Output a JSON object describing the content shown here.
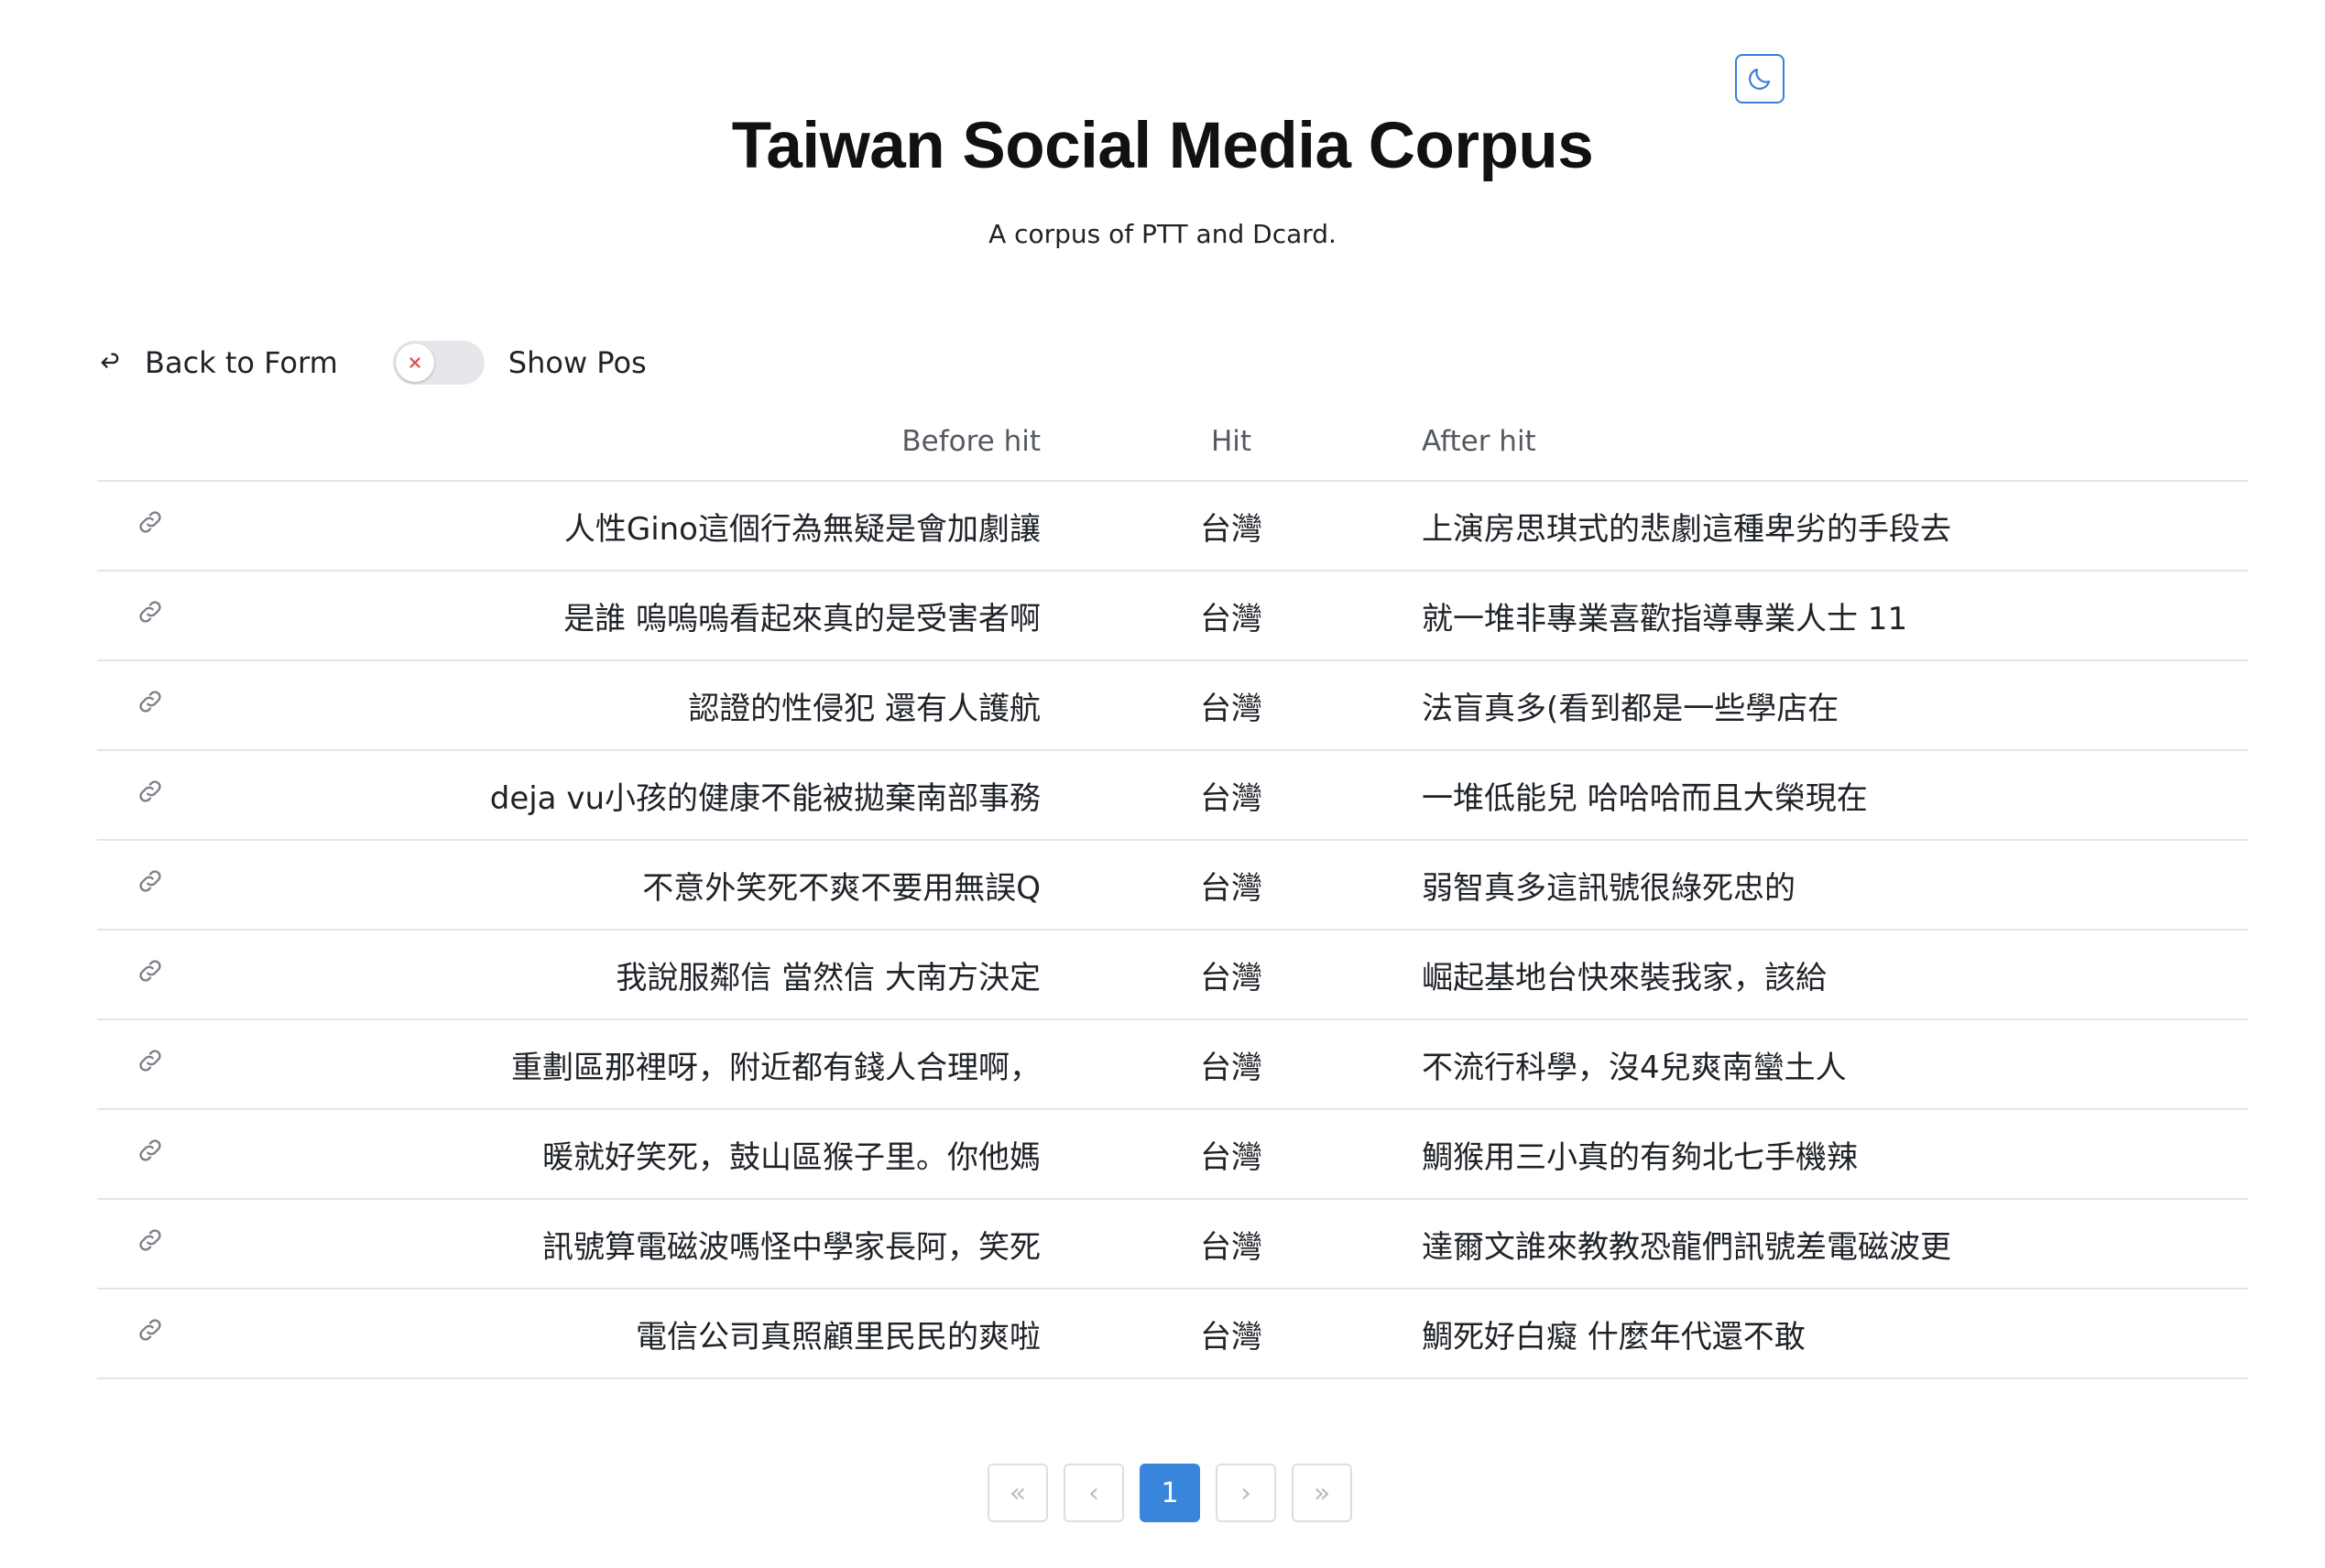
{
  "header": {
    "title": "Taiwan Social Media Corpus",
    "subtitle": "A corpus of PTT and Dcard.",
    "theme_toggle_icon": "moon-icon"
  },
  "controls": {
    "back_label": "Back to Form",
    "show_pos_label": "Show Pos",
    "show_pos_enabled": false
  },
  "table": {
    "columns": [
      "Before hit",
      "Hit",
      "After hit"
    ],
    "rows": [
      {
        "before": "人性Gino這個行為無疑是會加劇讓",
        "hit": "台灣",
        "after": "上演房思琪式的悲劇這種卑劣的手段去"
      },
      {
        "before": "是誰 嗚嗚嗚看起來真的是受害者啊",
        "hit": "台灣",
        "after": "就一堆非專業喜歡指導專業人士 11"
      },
      {
        "before": "認證的性侵犯 還有人護航",
        "hit": "台灣",
        "after": "法盲真多(看到都是一些學店在"
      },
      {
        "before": "deja vu小孩的健康不能被拋棄南部事務",
        "hit": "台灣",
        "after": "一堆低能兒 哈哈哈而且大榮現在"
      },
      {
        "before": "不意外笑死不爽不要用無誤Q",
        "hit": "台灣",
        "after": "弱智真多這訊號很綠死忠的"
      },
      {
        "before": "我說服鄰信 當然信 大南方決定",
        "hit": "台灣",
        "after": "崛起基地台快來裝我家，該給"
      },
      {
        "before": "重劃區那裡呀，附近都有錢人合理啊，",
        "hit": "台灣",
        "after": "不流行科學，沒4兒爽南蠻土人"
      },
      {
        "before": "暖就好笑死，鼓山區猴子里。你他媽",
        "hit": "台灣",
        "after": "鯛猴用三小真的有夠北七手機辣"
      },
      {
        "before": "訊號算電磁波嗎怪中學家長阿，笑死",
        "hit": "台灣",
        "after": "達爾文誰來教教恐龍們訊號差電磁波更"
      },
      {
        "before": "電信公司真照顧里民民的爽啦",
        "hit": "台灣",
        "after": "鯛死好白癡 什麼年代還不敢"
      }
    ]
  },
  "pagination": {
    "first": "«",
    "prev": "‹",
    "current_page": "1",
    "next": "›",
    "last": "»"
  },
  "colors": {
    "accent": "#3a85dc",
    "border": "#e4e5e7",
    "switch_off": "#e6e7ea",
    "switch_x": "#e5484d"
  }
}
